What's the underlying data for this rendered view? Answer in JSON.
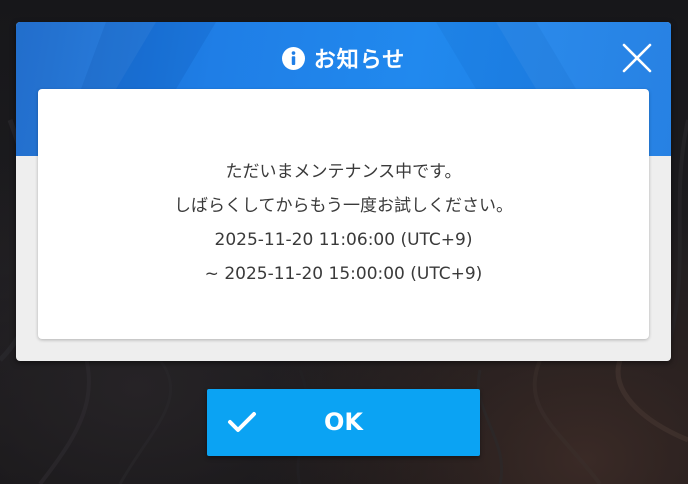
{
  "dialog": {
    "title": "お知らせ",
    "title_icon": "info-icon",
    "close_icon": "close-icon",
    "message_lines": [
      "ただいまメンテナンス中です。",
      "しばらくしてからもう一度お試しください。",
      "2025-11-20 11:06:00 (UTC+9)",
      "~ 2025-11-20 15:00:00 (UTC+9)"
    ]
  },
  "ok_button": {
    "label": "OK",
    "icon": "checkmark-icon"
  },
  "colors": {
    "header_blue": "#1f7ee6",
    "button_blue": "#0ba3f3",
    "dialog_bg": "#eeeeee",
    "card_bg": "#ffffff",
    "text": "#3a3a3a"
  }
}
